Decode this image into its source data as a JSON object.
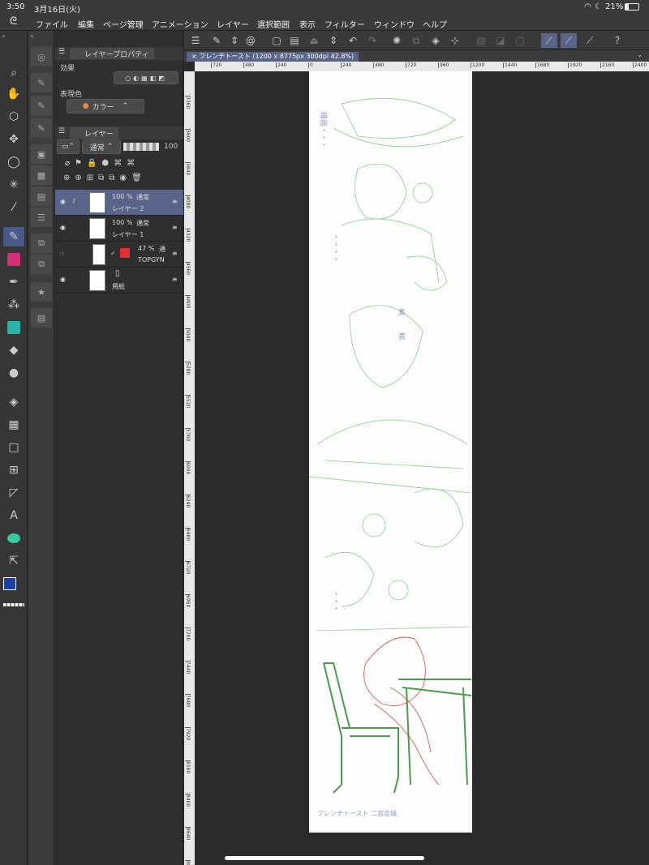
{
  "status": {
    "time": "3:50",
    "date": "3月16日(火)",
    "battery": "21%"
  },
  "menu": [
    "ファイル",
    "編集",
    "ページ管理",
    "アニメーション",
    "レイヤー",
    "選択範囲",
    "表示",
    "フィルター",
    "ウィンドウ",
    "ヘルプ"
  ],
  "layer_property": {
    "tab": "レイヤープロパティ",
    "effect_label": "効果",
    "expression_label": "表現色",
    "expression_value": "カラー"
  },
  "layers_panel": {
    "tab": "レイヤー",
    "blend_mode": "通常",
    "opacity": "100",
    "layers": [
      {
        "percent": "100 %",
        "mode": "通常",
        "name": "レイヤー 2",
        "selected": true
      },
      {
        "percent": "100 %",
        "mode": "通常",
        "name": "レイヤー 1",
        "selected": false
      },
      {
        "percent": "47 %",
        "mode": "通",
        "name": "TOPGYN",
        "selected": false
      },
      {
        "percent": "",
        "mode": "",
        "name": "用紙",
        "selected": false
      }
    ]
  },
  "document": {
    "tab_title": "フレンチトースト (1200 x 8775px 300dpi 42.8%)"
  },
  "ruler_h": [
    "720",
    "480",
    "240",
    "0",
    "240",
    "480",
    "720",
    "960",
    "1200",
    "1440",
    "1680",
    "1920",
    "2160",
    "2400"
  ],
  "ruler_v": [
    "3360",
    "3600",
    "3840",
    "4080",
    "4320",
    "4560",
    "4800",
    "5040",
    "5280",
    "5520",
    "5760",
    "6000",
    "6240",
    "6480",
    "6720",
    "6960",
    "7200",
    "7440",
    "7680",
    "7920",
    "8160",
    "8400",
    "8640",
    "8880"
  ],
  "canvas_caption": "フレンチトースト 二宮杏城",
  "colors": {
    "main": "#1c3fa8",
    "sub": "#ffffff",
    "accent": "#5a6488"
  }
}
